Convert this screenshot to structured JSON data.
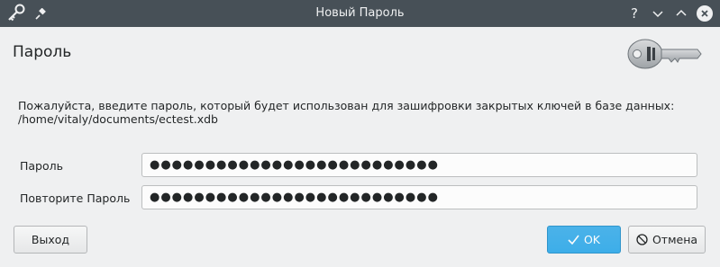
{
  "window": {
    "title": "Новый Пароль",
    "help_glyph": "?",
    "minimize_glyph": "⌄",
    "maximize_glyph": "⌃",
    "close_glyph": "✕",
    "app_icon": "key-icon",
    "pin_icon": "pin-icon"
  },
  "header": {
    "title": "Пароль",
    "image": "key-image"
  },
  "description": {
    "line1": "Пожалуйста, введите пароль, который будет использован для зашифровки закрытых ключей в базе данных:",
    "line2": "/home/vitaly/documents/ectest.xdb"
  },
  "form": {
    "password_label": "Пароль",
    "password_value": "●●●●●●●●●●●●●●●●●●●●●●●●●●",
    "repeat_label": "Повторите Пароль",
    "repeat_value": "●●●●●●●●●●●●●●●●●●●●●●●●●●"
  },
  "buttons": {
    "exit_label": "Выход",
    "ok_label": "OK",
    "ok_icon": "checkmark-icon",
    "cancel_label": "Отмена",
    "cancel_icon": "cancel-icon"
  },
  "colors": {
    "titlebar": "#475057",
    "window_bg": "#eff0f1",
    "accent": "#3daee9"
  }
}
